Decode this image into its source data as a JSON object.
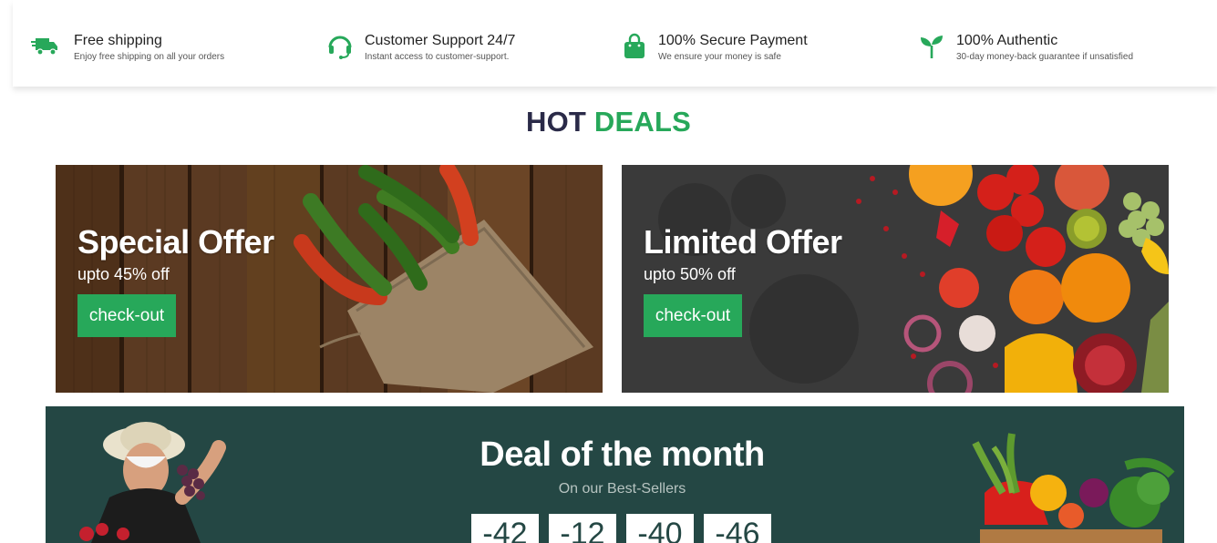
{
  "features": [
    {
      "title": "Free shipping",
      "subtitle": "Enjoy free shipping on all your orders",
      "icon": "truck-icon"
    },
    {
      "title": "Customer Support 24/7",
      "subtitle": "Instant access to customer-support.",
      "icon": "headset-icon"
    },
    {
      "title": "100% Secure Payment",
      "subtitle": "We ensure your money is safe",
      "icon": "shopping-bag-icon"
    },
    {
      "title": "100% Authentic",
      "subtitle": "30-day money-back guarantee if unsatisfied",
      "icon": "sprout-icon"
    }
  ],
  "hot_deals": {
    "word1": "HOT",
    "word2": "DEALS"
  },
  "offers": [
    {
      "title": "Special Offer",
      "subtitle": "upto 45% off",
      "button": "check-out",
      "image": "chili peppers in burlap sack on wooden table"
    },
    {
      "title": "Limited Offer",
      "subtitle": "upto 50% off",
      "button": "check-out",
      "image": "assorted fruits on dark stone surface"
    }
  ],
  "deal_of_month": {
    "title": "Deal of the month",
    "subtitle": "On our Best-Sellers",
    "countdown": [
      "-42",
      "-12",
      "-40",
      "-46"
    ]
  },
  "colors": {
    "accent": "#27a85a",
    "heading_dark": "#2a2a48",
    "deal_bg": "#244744"
  }
}
